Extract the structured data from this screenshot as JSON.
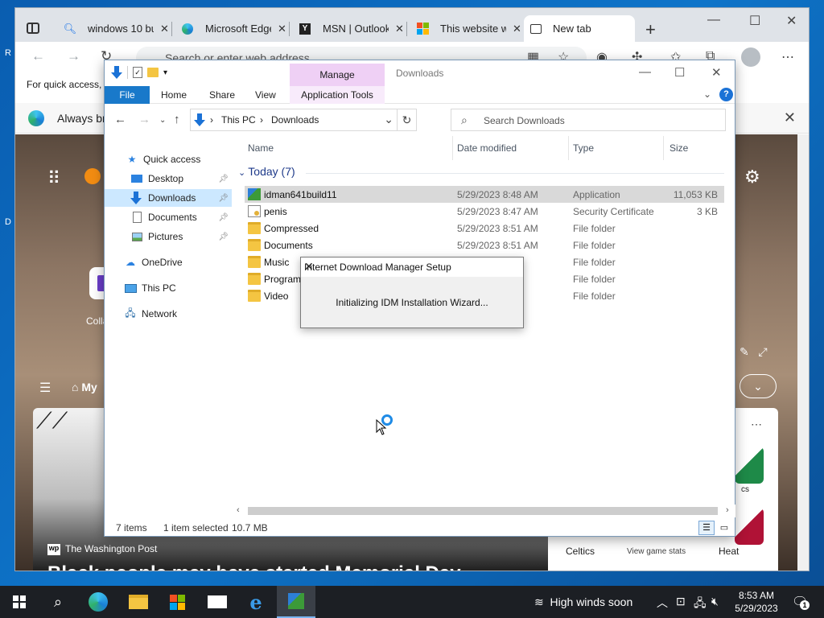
{
  "browser": {
    "tabs": [
      {
        "label": "windows 10 bu",
        "icon": "search-icon"
      },
      {
        "label": "Microsoft Edge",
        "icon": "edge-icon"
      },
      {
        "label": "MSN | Outlook",
        "icon": "msn-icon"
      },
      {
        "label": "This website w",
        "icon": "windows-logo-icon"
      },
      {
        "label": "New tab",
        "icon": "newtab-icon"
      }
    ],
    "address_placeholder": "Search or enter web address",
    "favorites_bar_text": "For quick access, p",
    "infobar_text": "Always bro"
  },
  "msn": {
    "tile_label": "Colla",
    "feed_label": "My",
    "news_source": "The Washington Post",
    "news_headline": "Black people may have started Memorial Day",
    "sports": {
      "home_team": "Celtics",
      "away_team": "Heat",
      "stats_link": "View game stats",
      "small_label": "cs"
    }
  },
  "explorer": {
    "title": "Downloads",
    "manage_label": "Manage",
    "ribbon_tabs": [
      "File",
      "Home",
      "Share",
      "View",
      "Application Tools"
    ],
    "breadcrumb": [
      "This PC",
      "Downloads"
    ],
    "search_placeholder": "Search Downloads",
    "nav": [
      {
        "label": "Quick access",
        "pinned": false
      },
      {
        "label": "Desktop",
        "pinned": true
      },
      {
        "label": "Downloads",
        "pinned": true
      },
      {
        "label": "Documents",
        "pinned": true
      },
      {
        "label": "Pictures",
        "pinned": true
      },
      {
        "label": "OneDrive",
        "pinned": false
      },
      {
        "label": "This PC",
        "pinned": false
      },
      {
        "label": "Network",
        "pinned": false
      }
    ],
    "columns": [
      "Name",
      "Date modified",
      "Type",
      "Size"
    ],
    "group_label": "Today (7)",
    "files": [
      {
        "name": "idman641build11",
        "date": "5/29/2023 8:48 AM",
        "type": "Application",
        "size": "11,053 KB",
        "icon": "application-icon"
      },
      {
        "name": "penis",
        "date": "5/29/2023 8:47 AM",
        "type": "Security Certificate",
        "size": "3 KB",
        "icon": "certificate-icon"
      },
      {
        "name": "Compressed",
        "date": "5/29/2023 8:51 AM",
        "type": "File folder",
        "size": "",
        "icon": "folder-icon"
      },
      {
        "name": "Documents",
        "date": "5/29/2023 8:51 AM",
        "type": "File folder",
        "size": "",
        "icon": "folder-icon"
      },
      {
        "name": "Music",
        "date": "",
        "type": "File folder",
        "size": "",
        "icon": "folder-icon"
      },
      {
        "name": "Program",
        "date": "",
        "type": "File folder",
        "size": "",
        "icon": "folder-icon"
      },
      {
        "name": "Video",
        "date": "",
        "type": "File folder",
        "size": "",
        "icon": "folder-icon"
      }
    ],
    "status": {
      "count": "7 items",
      "selected": "1 item selected",
      "size": "10.7 MB"
    }
  },
  "idm_dialog": {
    "title": "Internet Download Manager Setup",
    "message": "Initializing IDM Installation Wizard..."
  },
  "taskbar": {
    "weather": "High winds soon",
    "time": "8:53 AM",
    "date": "5/29/2023",
    "notification_count": "1"
  }
}
